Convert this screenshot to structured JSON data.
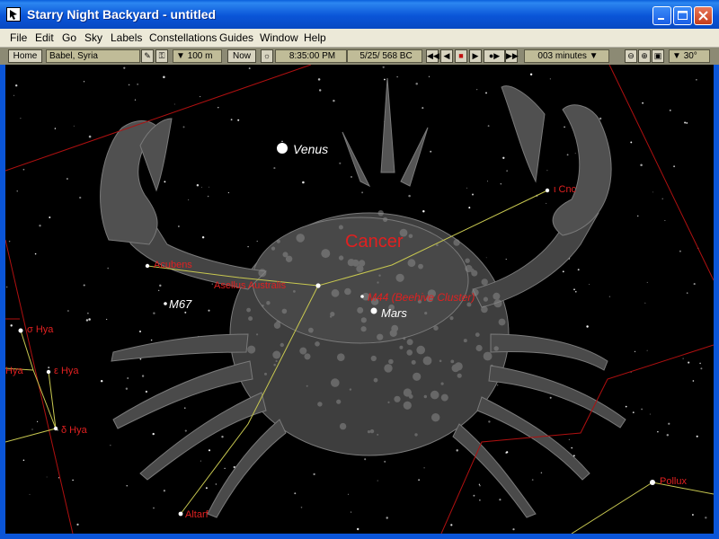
{
  "window": {
    "title": "Starry Night Backyard - untitled",
    "minimize_label": "minimize",
    "maximize_label": "maximize",
    "close_label": "close"
  },
  "menu": [
    "File",
    "Edit",
    "Go",
    "Sky",
    "Labels",
    "Constellations",
    "Guides",
    "Window",
    "Help"
  ],
  "toolbar": {
    "home_label": "Home",
    "location": "Babel, Syria",
    "elevation": "100 m",
    "now_label": "Now",
    "time": "8:35:00 PM",
    "date": "5/25/ 568 BC",
    "time_step": "003 minutes",
    "fov": "30°"
  },
  "sky": {
    "constellation_name": "Cancer",
    "objects": {
      "venus": "Venus",
      "mars": "Mars",
      "m67": "M67",
      "m44": "M44 (Beehive Cluster)"
    },
    "stars": {
      "acubens": "Acubens",
      "asellus_australis": "Asellus Australis",
      "iota_cnc": "ι Cnc",
      "sigma_hya": "σ Hya",
      "epsilon_hya": "ε Hya",
      "hya_partial": "Hya",
      "delta_hya": "δ Hya",
      "altarf": "Altarf",
      "pollux": "Pollux"
    }
  },
  "colors": {
    "label_red": "#e02020",
    "boundary_red": "#b01010",
    "line_yellow": "#c8c850",
    "sky_bg": "#000000",
    "title_blue": "#0a55d8"
  }
}
